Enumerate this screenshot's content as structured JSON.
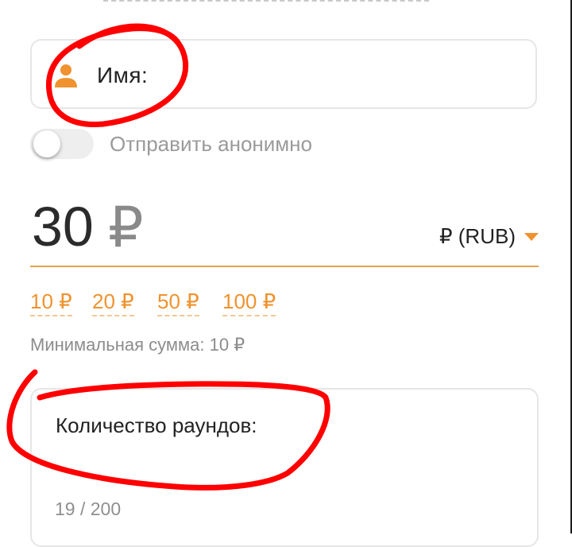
{
  "name_field": {
    "label": "Имя:"
  },
  "anonymous": {
    "label": "Отправить анонимно",
    "enabled": false
  },
  "amount": {
    "value": "30",
    "currency_symbol": "₽"
  },
  "currency_select": {
    "selected": "₽ (RUB)"
  },
  "presets": [
    "10 ₽",
    "20 ₽",
    "50 ₽",
    "100 ₽"
  ],
  "minimum_note": "Минимальная сумма: 10 ₽",
  "rounds_field": {
    "label": "Количество раундов:",
    "counter": "19 / 200"
  },
  "colors": {
    "accent": "#f0922e",
    "annotation": "#ff0000",
    "border": "#e6e6e6"
  },
  "icons": {
    "name_field": "person-icon",
    "currency_select": "caret-down-icon"
  }
}
